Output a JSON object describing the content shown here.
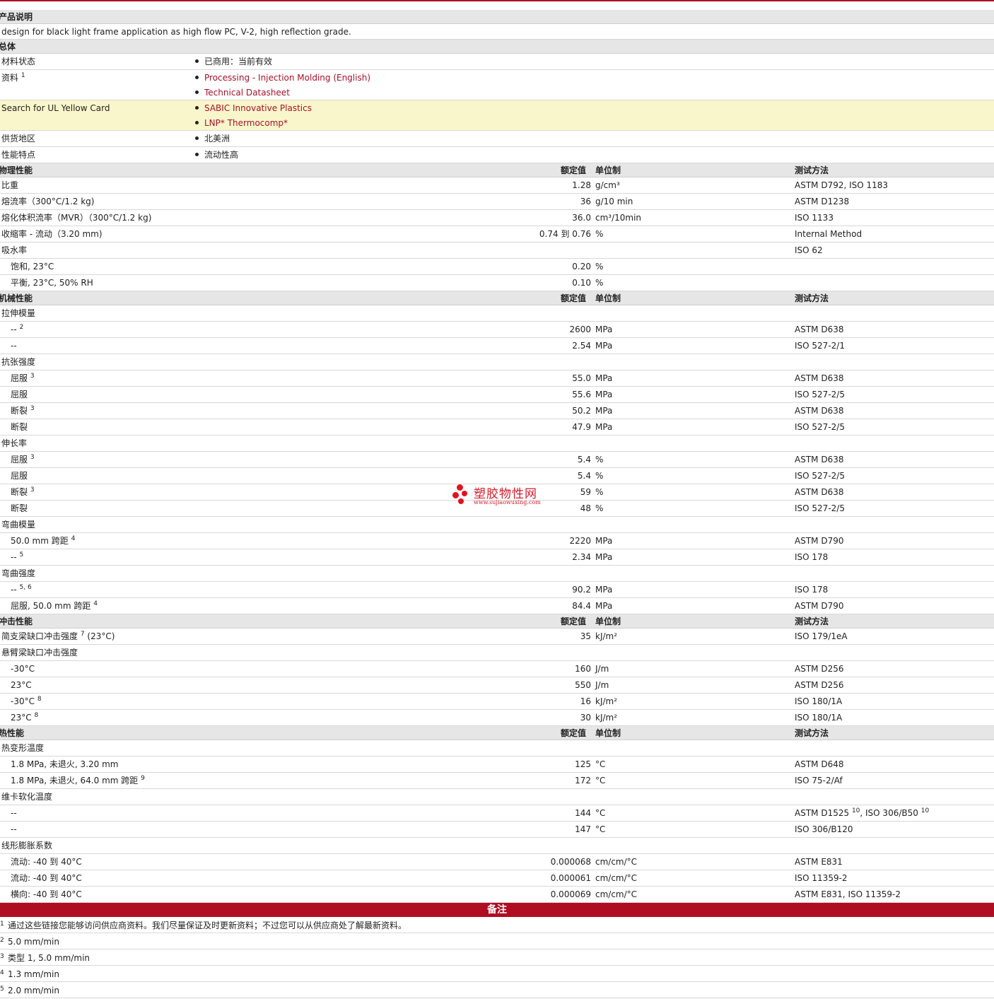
{
  "product_desc": {
    "header": "产品说明",
    "text": "design for black light frame application as high flow PC, V-2, high reflection grade."
  },
  "general": {
    "header": "总体",
    "rows": [
      {
        "label": "材料状态",
        "items": [
          "已商用：当前有效"
        ]
      },
      {
        "label": "资料",
        "sup": "1",
        "items": [
          "Processing - Injection Molding (English)",
          "Technical Datasheet"
        ],
        "links": true
      },
      {
        "label": "Search for UL Yellow Card",
        "items": [
          "SABIC Innovative Plastics",
          "LNP* Thermocomp*"
        ],
        "links": true,
        "highlight": true
      },
      {
        "label": "供货地区",
        "items": [
          "北美洲"
        ]
      },
      {
        "label": "性能特点",
        "items": [
          "流动性高"
        ]
      }
    ]
  },
  "col_headers": {
    "value": "额定值",
    "unit": "单位制",
    "test": "测试方法"
  },
  "sections": [
    {
      "title": "物理性能",
      "rows": [
        {
          "name": "比重",
          "value": "1.28",
          "unit": "g/cm³",
          "test": "ASTM D792, ISO 1183"
        },
        {
          "name": "熔流率（300°C/1.2 kg)",
          "value": "36",
          "unit": "g/10 min",
          "test": "ASTM D1238"
        },
        {
          "name": "熔化体积流率（MVR）（300°C/1.2 kg)",
          "value": "36.0",
          "unit": "cm³/10min",
          "test": "ISO 1133"
        },
        {
          "name": "收缩率  - 流动（3.20 mm)",
          "value": "0.74 到  0.76",
          "unit": "%",
          "test": "Internal Method"
        },
        {
          "name": "吸水率",
          "value": "",
          "unit": "",
          "test": "ISO 62"
        },
        {
          "name": "饱和, 23°C",
          "indent": true,
          "value": "0.20",
          "unit": "%",
          "test": ""
        },
        {
          "name": "平衡, 23°C, 50% RH",
          "indent": true,
          "value": "0.10",
          "unit": "%",
          "test": ""
        }
      ]
    },
    {
      "title": "机械性能",
      "rows": [
        {
          "name": "拉伸模量",
          "value": "",
          "unit": "",
          "test": ""
        },
        {
          "name": "--",
          "sup": "2",
          "indent": true,
          "value": "2600",
          "unit": "MPa",
          "test": "ASTM D638"
        },
        {
          "name": "--",
          "indent": true,
          "value": "2.54",
          "unit": "MPa",
          "test": "ISO 527-2/1"
        },
        {
          "name": "抗张强度",
          "value": "",
          "unit": "",
          "test": ""
        },
        {
          "name": "屈服",
          "sup": "3",
          "indent": true,
          "value": "55.0",
          "unit": "MPa",
          "test": "ASTM D638"
        },
        {
          "name": "屈服",
          "indent": true,
          "value": "55.6",
          "unit": "MPa",
          "test": "ISO 527-2/5"
        },
        {
          "name": "断裂",
          "sup": "3",
          "indent": true,
          "value": "50.2",
          "unit": "MPa",
          "test": "ASTM D638"
        },
        {
          "name": "断裂",
          "indent": true,
          "value": "47.9",
          "unit": "MPa",
          "test": "ISO 527-2/5"
        },
        {
          "name": "伸长率",
          "value": "",
          "unit": "",
          "test": ""
        },
        {
          "name": "屈服",
          "sup": "3",
          "indent": true,
          "value": "5.4",
          "unit": "%",
          "test": "ASTM D638"
        },
        {
          "name": "屈服",
          "indent": true,
          "value": "5.4",
          "unit": "%",
          "test": "ISO 527-2/5"
        },
        {
          "name": "断裂",
          "sup": "3",
          "indent": true,
          "value": "59",
          "unit": "%",
          "test": "ASTM D638"
        },
        {
          "name": "断裂",
          "indent": true,
          "value": "48",
          "unit": "%",
          "test": "ISO 527-2/5"
        },
        {
          "name": "弯曲模量",
          "value": "",
          "unit": "",
          "test": ""
        },
        {
          "name": "50.0 mm 跨距",
          "sup": "4",
          "indent": true,
          "value": "2220",
          "unit": "MPa",
          "test": "ASTM D790"
        },
        {
          "name": "--",
          "sup": "5",
          "indent": true,
          "value": "2.34",
          "unit": "MPa",
          "test": "ISO 178"
        },
        {
          "name": "弯曲强度",
          "value": "",
          "unit": "",
          "test": ""
        },
        {
          "name": "--",
          "sup": "5, 6",
          "indent": true,
          "value": "90.2",
          "unit": "MPa",
          "test": "ISO 178"
        },
        {
          "name": "屈服, 50.0 mm 跨距",
          "sup": "4",
          "indent": true,
          "value": "84.4",
          "unit": "MPa",
          "test": "ASTM D790"
        }
      ]
    },
    {
      "title": "冲击性能",
      "rows": [
        {
          "name": "简支梁缺口冲击强度",
          "sup": "7",
          "suffix": "(23°C)",
          "value": "35",
          "unit": "kJ/m²",
          "test": "ISO 179/1eA"
        },
        {
          "name": "悬臂梁缺口冲击强度",
          "value": "",
          "unit": "",
          "test": ""
        },
        {
          "name": "-30°C",
          "indent": true,
          "value": "160",
          "unit": "J/m",
          "test": "ASTM D256"
        },
        {
          "name": "23°C",
          "indent": true,
          "value": "550",
          "unit": "J/m",
          "test": "ASTM D256"
        },
        {
          "name": "-30°C",
          "sup": "8",
          "indent": true,
          "value": "16",
          "unit": "kJ/m²",
          "test": "ISO 180/1A"
        },
        {
          "name": "23°C",
          "sup": "8",
          "indent": true,
          "value": "30",
          "unit": "kJ/m²",
          "test": "ISO 180/1A"
        }
      ]
    },
    {
      "title": "热性能",
      "rows": [
        {
          "name": "热变形温度",
          "value": "",
          "unit": "",
          "test": ""
        },
        {
          "name": "1.8 MPa, 未退火, 3.20 mm",
          "indent": true,
          "value": "125",
          "unit": "°C",
          "test": "ASTM D648"
        },
        {
          "name": "1.8 MPa, 未退火, 64.0 mm 跨距",
          "sup": "9",
          "indent": true,
          "value": "172",
          "unit": "°C",
          "test": "ISO 75-2/Af"
        },
        {
          "name": "维卡软化温度",
          "value": "",
          "unit": "",
          "test": ""
        },
        {
          "name": "--",
          "indent": true,
          "value": "144",
          "unit": "°C",
          "test": "ASTM D1525",
          "test_sup": "10",
          "test2": ", ISO 306/B50",
          "test2_sup": "10"
        },
        {
          "name": "--",
          "indent": true,
          "value": "147",
          "unit": "°C",
          "test": "ISO 306/B120"
        },
        {
          "name": "线形膨胀系数",
          "value": "",
          "unit": "",
          "test": ""
        },
        {
          "name": "流动: -40 到  40°C",
          "indent": true,
          "value": "0.000068",
          "unit": "cm/cm/°C",
          "test": "ASTM E831"
        },
        {
          "name": "流动: -40 到  40°C",
          "indent": true,
          "value": "0.000061",
          "unit": "cm/cm/°C",
          "test": "ISO 11359-2"
        },
        {
          "name": "横向: -40 到  40°C",
          "indent": true,
          "value": "0.000069",
          "unit": "cm/cm/°C",
          "test": "ASTM E831, ISO 11359-2"
        }
      ]
    }
  ],
  "notes": {
    "header": "备注",
    "items": [
      {
        "n": "1",
        "text": "通过这些链接您能够访问供应商资料。我们尽量保证及时更新资料；不过您可以从供应商处了解最新资料。"
      },
      {
        "n": "2",
        "text": "5.0 mm/min"
      },
      {
        "n": "3",
        "text": "类型  1, 5.0 mm/min"
      },
      {
        "n": "4",
        "text": "1.3 mm/min"
      },
      {
        "n": "5",
        "text": "2.0 mm/min"
      }
    ]
  },
  "watermark": {
    "cn": "塑胶物性网",
    "en": "www.sujiaowuxing.com"
  }
}
